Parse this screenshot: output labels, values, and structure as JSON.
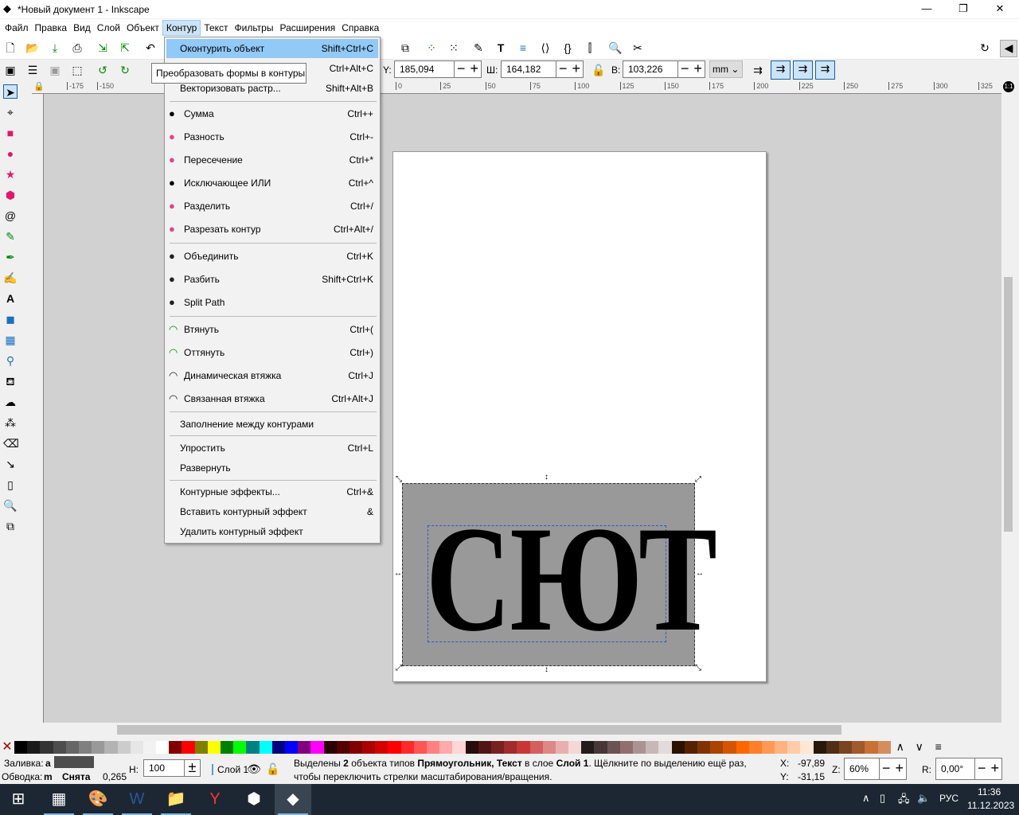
{
  "window": {
    "title": "*Новый документ 1 - Inkscape",
    "minimize": "—",
    "maximize": "❐",
    "close": "✕"
  },
  "menubar": [
    "Файл",
    "Правка",
    "Вид",
    "Слой",
    "Объект",
    "Контур",
    "Текст",
    "Фильтры",
    "Расширения",
    "Справка"
  ],
  "active_menu": "Контур",
  "toolbar2": {
    "y_label": "Y:",
    "y_value": "185,094",
    "w_label": "Ш:",
    "w_value": "164,182",
    "h_label": "В:",
    "h_value": "103,226",
    "unit": "mm",
    "lock_icon": "lock-open-icon"
  },
  "ruler": {
    "labels": [
      "-175",
      "-150",
      "0",
      "25",
      "50",
      "75",
      "100",
      "125",
      "150",
      "175",
      "200",
      "225",
      "250",
      "275",
      "300",
      "325"
    ],
    "zoom_badge": "1:1"
  },
  "canvas": {
    "text": "СЮТ",
    "rect_color": "#999999"
  },
  "tooltip": "Преобразовать формы в контуры",
  "path_menu": [
    {
      "label": "Оконтурить объект",
      "shortcut": "Shift+Ctrl+C",
      "highlighted": true
    },
    {
      "label": "Объект в контур",
      "shortcut": "Ctrl+Alt+C"
    },
    {
      "label": "Векторизовать растр...",
      "shortcut": "Shift+Alt+B"
    },
    {
      "label": "Сумма",
      "shortcut": "Ctrl++",
      "icon": "union-icon"
    },
    {
      "label": "Разность",
      "shortcut": "Ctrl+-",
      "icon": "difference-icon"
    },
    {
      "label": "Пересечение",
      "shortcut": "Ctrl+*",
      "icon": "intersection-icon"
    },
    {
      "label": "Исключающее ИЛИ",
      "shortcut": "Ctrl+^",
      "icon": "exclusion-icon"
    },
    {
      "label": "Разделить",
      "shortcut": "Ctrl+/",
      "icon": "division-icon"
    },
    {
      "label": "Разрезать контур",
      "shortcut": "Ctrl+Alt+/",
      "icon": "cut-path-icon"
    },
    {
      "label": "Объединить",
      "shortcut": "Ctrl+K",
      "icon": "combine-icon"
    },
    {
      "label": "Разбить",
      "shortcut": "Shift+Ctrl+K",
      "icon": "break-apart-icon"
    },
    {
      "label": "Split Path",
      "shortcut": "",
      "icon": "split-path-icon"
    },
    {
      "label": "Втянуть",
      "shortcut": "Ctrl+(",
      "icon": "inset-icon"
    },
    {
      "label": "Оттянуть",
      "shortcut": "Ctrl+)",
      "icon": "outset-icon"
    },
    {
      "label": "Динамическая втяжка",
      "shortcut": "Ctrl+J",
      "icon": "dynamic-offset-icon"
    },
    {
      "label": "Связанная втяжка",
      "shortcut": "Ctrl+Alt+J",
      "icon": "linked-offset-icon"
    },
    {
      "label": "Заполнение между контурами",
      "shortcut": ""
    },
    {
      "label": "Упростить",
      "shortcut": "Ctrl+L"
    },
    {
      "label": "Развернуть",
      "shortcut": ""
    },
    {
      "label": "Контурные эффекты...",
      "shortcut": "Ctrl+&"
    },
    {
      "label": "Вставить контурный эффект",
      "shortcut": "&"
    },
    {
      "label": "Удалить контурный эффект",
      "shortcut": ""
    }
  ],
  "palette": [
    "#000000",
    "#1a1a1a",
    "#333333",
    "#4d4d4d",
    "#666666",
    "#808080",
    "#999999",
    "#b3b3b3",
    "#cccccc",
    "#e6e6e6",
    "#f2f2f2",
    "#ffffff",
    "#800000",
    "#ff0000",
    "#808000",
    "#ffff00",
    "#008000",
    "#00ff00",
    "#008080",
    "#00ffff",
    "#000080",
    "#0000ff",
    "#800080",
    "#ff00ff",
    "#2b0000",
    "#550000",
    "#800000",
    "#aa0000",
    "#d40000",
    "#ff0000",
    "#ff2a2a",
    "#ff5555",
    "#ff8080",
    "#ffaaaa",
    "#ffd5d5",
    "#280b0b",
    "#501616",
    "#782121",
    "#a02c2c",
    "#c83737",
    "#d35f5f",
    "#de8787",
    "#e9afaf",
    "#f4d7d7",
    "#241c1c",
    "#483737",
    "#6c5353",
    "#916f6f",
    "#ac9393",
    "#c8b7b7",
    "#e3dbdb",
    "#2b1100",
    "#552200",
    "#803300",
    "#aa4400",
    "#d45500",
    "#ff6600",
    "#ff7f2a",
    "#ff9955",
    "#ffb380",
    "#ffccaa",
    "#ffe6d5",
    "#28170b",
    "#502d16",
    "#784421",
    "#a05a2c",
    "#c87137",
    "#d38d5f"
  ],
  "status": {
    "fill_label": "Заливка:",
    "fill_value": "a",
    "fill_color": "#4d4d4d",
    "stroke_label": "Обводка:",
    "stroke_value": "m",
    "stroke_none": "Снята",
    "stroke_width": "0,265",
    "opacity_label": "Н:",
    "opacity_value": "100",
    "layer": "Слой 1",
    "message_pre": "Выделены ",
    "count": "2",
    "message_mid": " объекта типов ",
    "types": "Прямоугольник, Текст",
    "message_layer_pre": " в слое ",
    "layer_name": "Слой 1",
    "message_post": ". Щёлкните по выделению ещё раз, чтобы переключить стрелки масштабирования/вращения.",
    "x_label": "X:",
    "x_value": "-97,89",
    "y_label": "Y:",
    "y_value": "-31,15",
    "zoom_label": "Z:",
    "zoom_value": "60%",
    "rot_label": "R:",
    "rot_value": "0,00°"
  },
  "taskbar": {
    "lang": "РУС",
    "time": "11:36",
    "date": "11.12.2023"
  }
}
